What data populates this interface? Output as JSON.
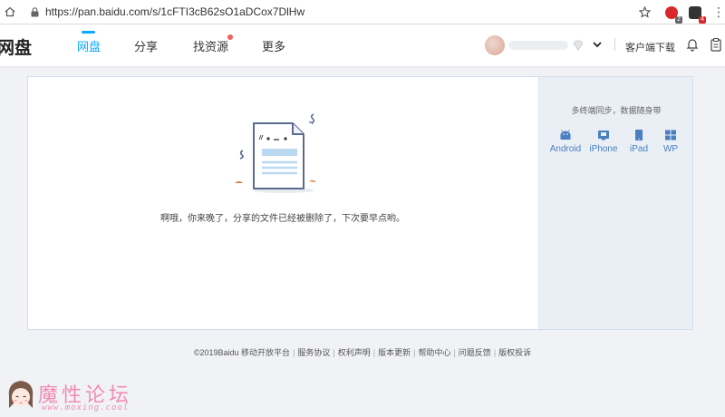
{
  "browser": {
    "url": "https://pan.baidu.com/s/1cFTI3cB62sO1aDCox7DlHw",
    "extensions": [
      {
        "icon": "red-extension-icon",
        "badge": "2"
      },
      {
        "icon": "dark-extension-icon",
        "badge": "4"
      }
    ]
  },
  "header": {
    "logo": "网盘",
    "nav": [
      "网盘",
      "分享",
      "找资源",
      "更多"
    ],
    "client_download": "客户端下载"
  },
  "main": {
    "empty_message": "啊哦，你来晚了，分享的文件已经被删除了，下次要早点哟。"
  },
  "sidebar": {
    "title": "多终端同步，数据随身带",
    "platforms": [
      {
        "label": "Android",
        "icon": "android-icon"
      },
      {
        "label": "iPhone",
        "icon": "iphone-icon"
      },
      {
        "label": "iPad",
        "icon": "ipad-icon"
      },
      {
        "label": "WP",
        "icon": "windows-icon"
      }
    ]
  },
  "footer": {
    "copyright": "©2019Baidu",
    "links": [
      "移动开放平台",
      "服务协议",
      "权利声明",
      "版本更新",
      "帮助中心",
      "问题反馈",
      "版权投诉"
    ]
  },
  "watermark": {
    "title": "魔性论坛",
    "url": "www.moxing.cool"
  },
  "colors": {
    "accent": "#09aaff",
    "watermark_pink": "#f08cb4"
  }
}
